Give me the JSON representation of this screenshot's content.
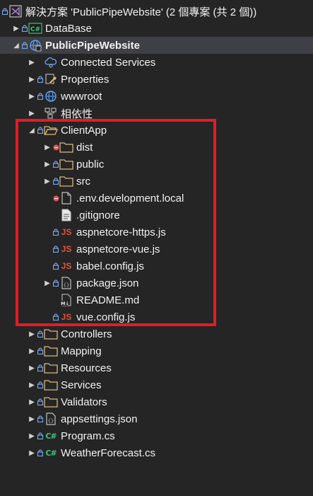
{
  "solution": {
    "label": "解決方案 'PublicPipeWebsite' (2 個專案 (共 2 個))"
  },
  "tree": {
    "database": "DataBase",
    "project": "PublicPipeWebsite",
    "connected_services": "Connected Services",
    "properties": "Properties",
    "wwwroot": "wwwroot",
    "dependencies": "相依性",
    "clientapp": "ClientApp",
    "dist": "dist",
    "public": "public",
    "src": "src",
    "env_local": ".env.development.local",
    "gitignore": ".gitignore",
    "aspnetcore_https": "aspnetcore-https.js",
    "aspnetcore_vue": "aspnetcore-vue.js",
    "babel_config": "babel.config.js",
    "package_json": "package.json",
    "readme": "README.md",
    "vue_config": "vue.config.js",
    "controllers": "Controllers",
    "mapping": "Mapping",
    "resources": "Resources",
    "services": "Services",
    "validators": "Validators",
    "appsettings": "appsettings.json",
    "program": "Program.cs",
    "weatherforecast": "WeatherForecast.cs"
  },
  "icons": {
    "csharp_glyph": "C#",
    "js_glyph": "JS",
    "markdown_glyph": "M↓",
    "json_glyph": "{}",
    "expand_collapsed": "▶",
    "expand_open": "◢"
  },
  "colors": {
    "background": "#252526",
    "highlight_border": "#e51b24",
    "folder": "#dcb67a",
    "lock": "#7aa7e8",
    "error": "#e05252"
  }
}
